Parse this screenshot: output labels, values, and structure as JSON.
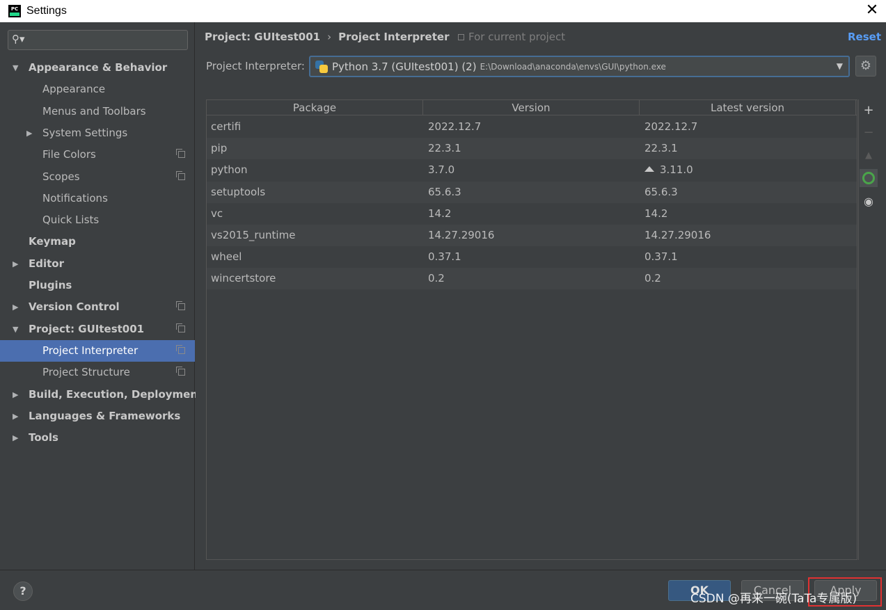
{
  "window": {
    "title": "Settings",
    "close_glyph": "✕"
  },
  "search": {
    "value": "",
    "placeholder": ""
  },
  "sidebar": {
    "items": [
      {
        "label": "Appearance & Behavior",
        "bold": true,
        "arrow": "expanded"
      },
      {
        "label": "Appearance"
      },
      {
        "label": "Menus and Toolbars"
      },
      {
        "label": "System Settings",
        "arrow": "collapsed"
      },
      {
        "label": "File Colors",
        "project_icon": true
      },
      {
        "label": "Scopes",
        "project_icon": true
      },
      {
        "label": "Notifications"
      },
      {
        "label": "Quick Lists"
      },
      {
        "label": "Keymap",
        "bold": true
      },
      {
        "label": "Editor",
        "bold": true,
        "arrow": "collapsed"
      },
      {
        "label": "Plugins",
        "bold": true
      },
      {
        "label": "Version Control",
        "bold": true,
        "arrow": "collapsed",
        "project_icon": true
      },
      {
        "label": "Project: GUItest001",
        "bold": true,
        "arrow": "expanded",
        "project_icon": true
      },
      {
        "label": "Project Interpreter",
        "selected": true,
        "project_icon": true
      },
      {
        "label": "Project Structure",
        "project_icon": true
      },
      {
        "label": "Build, Execution, Deployment",
        "bold": true,
        "arrow": "collapsed"
      },
      {
        "label": "Languages & Frameworks",
        "bold": true,
        "arrow": "collapsed"
      },
      {
        "label": "Tools",
        "bold": true,
        "arrow": "collapsed"
      }
    ]
  },
  "header": {
    "breadcrumb_project": "Project: GUItest001",
    "breadcrumb_sep": "›",
    "breadcrumb_page": "Project Interpreter",
    "for_current": "For current project",
    "reset": "Reset"
  },
  "interpreter": {
    "label": "Project Interpreter:",
    "name": "Python 3.7 (GUItest001) (2)",
    "path": "E:\\Download\\anaconda\\envs\\GUI\\python.exe"
  },
  "table": {
    "columns": [
      "Package",
      "Version",
      "Latest version"
    ],
    "rows": [
      {
        "package": "certifi",
        "version": "2022.12.7",
        "latest": "2022.12.7"
      },
      {
        "package": "pip",
        "version": "22.3.1",
        "latest": "22.3.1"
      },
      {
        "package": "python",
        "version": "3.7.0",
        "latest": "3.11.0",
        "upgrade": true
      },
      {
        "package": "setuptools",
        "version": "65.6.3",
        "latest": "65.6.3"
      },
      {
        "package": "vc",
        "version": "14.2",
        "latest": "14.2"
      },
      {
        "package": "vs2015_runtime",
        "version": "14.27.29016",
        "latest": "14.27.29016"
      },
      {
        "package": "wheel",
        "version": "0.37.1",
        "latest": "0.37.1"
      },
      {
        "package": "wincertstore",
        "version": "0.2",
        "latest": "0.2"
      }
    ]
  },
  "toolbar": {
    "add": "+",
    "remove": "−",
    "upgrade": "▲",
    "eye": "◉"
  },
  "footer": {
    "help": "?",
    "ok": "OK",
    "cancel": "Cancel",
    "apply": "Apply",
    "watermark": "CSDN @再来一碗(TaTa专属版)"
  },
  "colors": {
    "accent": "#4b6eaf",
    "link": "#589df6",
    "highlight_box": "#e03232"
  }
}
